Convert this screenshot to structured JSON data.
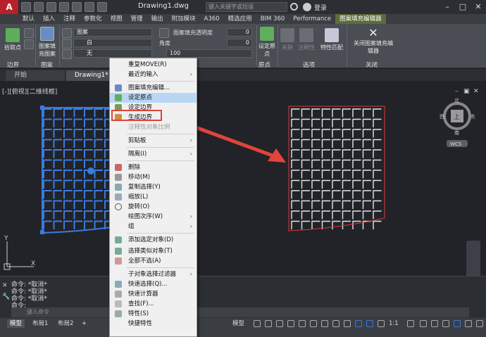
{
  "titlebar": {
    "document_title": "Drawing1.dwg",
    "search_placeholder": "键入关键字或短语",
    "login_label": "登录"
  },
  "ribbon_tabs": [
    "默认",
    "插入",
    "注释",
    "参数化",
    "视图",
    "管理",
    "输出",
    "附加模块",
    "A360",
    "精选应用",
    "BIM 360",
    "Performance",
    "图案填充编辑器"
  ],
  "ribbon": {
    "pick_points_label": "拾取点",
    "boundary_panel_label": "边界",
    "hatch_pattern_label": "图案填充图案",
    "pattern_panel_label": "图案",
    "pattern_type_value": "图案",
    "color_value": "白",
    "background_value": "无",
    "transparency_label": "图案填充透明度",
    "transparency_value": "0",
    "angle_label": "角度",
    "angle_value": "0",
    "scale_value": "100",
    "set_origin_label": "设定原点",
    "origin_panel_label": "原点",
    "associative_label": "关联",
    "annotative_label": "注释性",
    "match_properties_label": "特性匹配",
    "options_panel_label": "选项",
    "close_editor_label": "关闭图案填充编辑器",
    "close_panel_label": "关闭"
  },
  "file_tabs": {
    "start_label": "开始",
    "drawing_label": "Drawing1*"
  },
  "drawing": {
    "view_label": "[-][俯视][二维线框]",
    "viewcube": {
      "north": "北",
      "east": "东",
      "south": "南",
      "west": "西",
      "top": "上",
      "wcs": "WCS"
    },
    "ucs_x": "X",
    "ucs_y": "Y"
  },
  "context_menu": {
    "items": [
      {
        "label": "重复MOVE(R)"
      },
      {
        "label": "最近的输入",
        "submenu": true
      },
      {
        "label": "图案填充编辑..."
      },
      {
        "label": "设定原点",
        "highlighted": true
      },
      {
        "label": "设定边界"
      },
      {
        "label": "生成边界"
      },
      {
        "label": "注释性对象比例",
        "disabled": true
      },
      {
        "label": "剪贴板",
        "submenu": true
      },
      {
        "label": "隔离(I)",
        "submenu": true
      },
      {
        "label": "删除"
      },
      {
        "label": "移动(M)"
      },
      {
        "label": "复制选择(Y)"
      },
      {
        "label": "缩放(L)"
      },
      {
        "label": "旋转(O)"
      },
      {
        "label": "绘图次序(W)",
        "submenu": true
      },
      {
        "label": "组",
        "submenu": true
      },
      {
        "label": "添加选定对象(D)"
      },
      {
        "label": "选择类似对象(T)"
      },
      {
        "label": "全部不选(A)"
      },
      {
        "label": "子对象选择过滤器",
        "submenu": true
      },
      {
        "label": "快速选择(Q)..."
      },
      {
        "label": "快速计算器"
      },
      {
        "label": "查找(F)..."
      },
      {
        "label": "特性(S)"
      },
      {
        "label": "快捷特性"
      }
    ]
  },
  "command": {
    "lines": [
      "命令: *取消*",
      "命令: *取消*",
      "命令: *取消*",
      "命令:"
    ],
    "input_placeholder": "键入命令"
  },
  "statusbar": {
    "tabs": [
      "模型",
      "布局1",
      "布局2"
    ],
    "model_label": "模型",
    "scale_label": "1:1"
  },
  "colors": {
    "accent_blue": "#3a7be0",
    "hatch_red": "#e03a3a",
    "arrow_red": "#e0443a",
    "menu_highlight": "#b9d7f5"
  }
}
